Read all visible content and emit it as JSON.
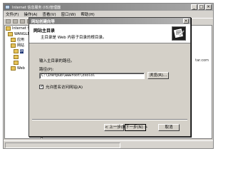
{
  "main_window": {
    "title": "Internet 信息服务 (IIS)管理器",
    "menu": [
      "文件(F)",
      "操作(A)",
      "查看(V)",
      "窗口(W)",
      "帮助(H)"
    ],
    "tree_nodes": [
      "Internet 信",
      "WANGLE",
      "应用",
      "网站",
      "默",
      "",
      "",
      "Web"
    ],
    "right_pane_text": "tar.com"
  },
  "wizard": {
    "title": "网站创建向导",
    "heading": "网站主目录",
    "subheading": "主目录是 Web 内容子目录的根目录。",
    "prompt": "输入主目录的路径。",
    "path_label": "路径(P):",
    "path_value": "C:\\Inetpub\\wwwroot\\zxolol",
    "browse_label": "浏览(R)...",
    "anonymous_label": "允许匿名访问网站(A)",
    "anonymous_checked": true,
    "back_label": "< 上一步(B)",
    "next_label": "下一步(N) >",
    "cancel_label": "取消"
  }
}
